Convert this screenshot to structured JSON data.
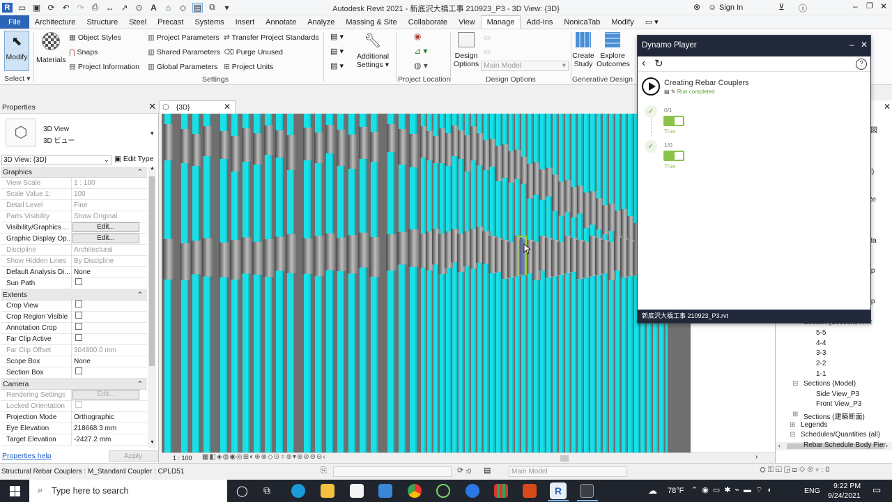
{
  "app": {
    "title": "Autodesk Revit 2021 - 新底沢大橋工事 210923_P3 - 3D View: {3D}",
    "sign_in": "Sign In"
  },
  "tabs": [
    "File",
    "Architecture",
    "Structure",
    "Steel",
    "Precast",
    "Systems",
    "Insert",
    "Annotate",
    "Analyze",
    "Massing & Site",
    "Collaborate",
    "View",
    "Manage",
    "Add-Ins",
    "NonicaTab",
    "Modify"
  ],
  "ribbon": {
    "modify": "Modify",
    "select": "Select",
    "materials": "Materials",
    "object_styles": "Object Styles",
    "snaps": "Snaps",
    "project_information": "Project Information",
    "project_parameters": "Project Parameters",
    "shared_parameters": "Shared Parameters",
    "global_parameters": "Global Parameters",
    "transfer_standards": "Transfer Project Standards",
    "purge_unused": "Purge Unused",
    "project_units": "Project Units",
    "settings_panel": "Settings",
    "additional_settings_1": "Additional",
    "additional_settings_2": "Settings",
    "project_location_panel": "Project Location",
    "design_options_1": "Design",
    "design_options_2": "Options",
    "main_model": "Main Model",
    "design_options_panel": "Design Options",
    "create_study_1": "Create",
    "create_study_2": "Study",
    "explore_outcomes_1": "Explore",
    "explore_outcomes_2": "Outcomes",
    "generative_design_panel": "Generative Design"
  },
  "properties": {
    "title": "Properties",
    "type_name": "3D View",
    "type_sub": "3D ビュー",
    "selector": "3D View: {3D}",
    "edit_type": "Edit Type",
    "groups": {
      "graphics": "Graphics",
      "extents": "Extents",
      "camera": "Camera"
    },
    "rows_graphics": [
      {
        "k": "View Scale",
        "v": "1 : 100",
        "dim": true
      },
      {
        "k": "Scale Value    1:",
        "v": "100",
        "dim": true
      },
      {
        "k": "Detail Level",
        "v": "Fine",
        "dim": true
      },
      {
        "k": "Parts Visibility",
        "v": "Show Original",
        "dim": true
      },
      {
        "k": "Visibility/Graphics ...",
        "v": "Edit...",
        "btn": true
      },
      {
        "k": "Graphic Display Op...",
        "v": "Edit...",
        "btn": true
      },
      {
        "k": "Discipline",
        "v": "Architectural",
        "dim": true
      },
      {
        "k": "Show Hidden Lines",
        "v": "By Discipline",
        "dim": true
      },
      {
        "k": "Default Analysis Di...",
        "v": "None"
      },
      {
        "k": "Sun Path",
        "v": "",
        "cb": true
      }
    ],
    "rows_extents": [
      {
        "k": "Crop View",
        "v": "",
        "cb": true
      },
      {
        "k": "Crop Region Visible",
        "v": "",
        "cb": true
      },
      {
        "k": "Annotation Crop",
        "v": "",
        "cb": true
      },
      {
        "k": "Far Clip Active",
        "v": "",
        "cb": true
      },
      {
        "k": "Far Clip Offset",
        "v": "304800.0 mm",
        "dim": true
      },
      {
        "k": "Scope Box",
        "v": "None"
      },
      {
        "k": "Section Box",
        "v": "",
        "cb": true
      }
    ],
    "rows_camera": [
      {
        "k": "Rendering Settings",
        "v": "Edit...",
        "btn": true,
        "dim": true
      },
      {
        "k": "Locked Orientation",
        "v": "",
        "cb": true,
        "dim": true
      },
      {
        "k": "Projection Mode",
        "v": "Orthographic"
      },
      {
        "k": "Eye Elevation",
        "v": "218668.3 mm"
      },
      {
        "k": "Target Elevation",
        "v": "-2427.2 mm"
      }
    ],
    "help": "Properties help",
    "apply": "Apply"
  },
  "view": {
    "tab": "{3D}",
    "scale": "1 : 100"
  },
  "dynamo": {
    "title": "Dynamo Player",
    "script": "Creating Rebar Couplers",
    "status": "Run completed",
    "inputs": [
      {
        "label": "0/1",
        "value": "True"
      },
      {
        "label": "1/0",
        "value": "True"
      }
    ],
    "file": "新底沢大橋工事 210923_P3.rvt"
  },
  "browser": {
    "nodes": [
      "5-5",
      "4-4",
      "3-3",
      "2-2",
      "1-1",
      "Sections (Model)",
      "Side View_P3",
      "Front View_P3",
      "Sections (建築断面)",
      "Legends",
      "Schedules/Quantities (all)",
      "Rebar Schedule Body Pier"
    ],
    "partial": [
      "伏図",
      "図)",
      "-Re",
      "nda",
      "rup",
      "rup",
      "Section (Sections R-R"
    ]
  },
  "statusbar": {
    "text": "Structural Rebar Couplers : M_Standard Coupler : CPLD51",
    "filter_count": ":0",
    "model": "Main Model"
  },
  "taskbar": {
    "search": "Type here to search",
    "weather": "78°F",
    "lang": "ENG",
    "time": "9:22 PM",
    "date": "9/24/2021"
  },
  "colors": {
    "rebar": "#19e0e6",
    "rebar_edge": "#0bb2bd",
    "background": "#6f6f6f",
    "file_tab": "#2b65b6",
    "dynamo_header": "#21283a",
    "toggle": "#8bc34a"
  }
}
